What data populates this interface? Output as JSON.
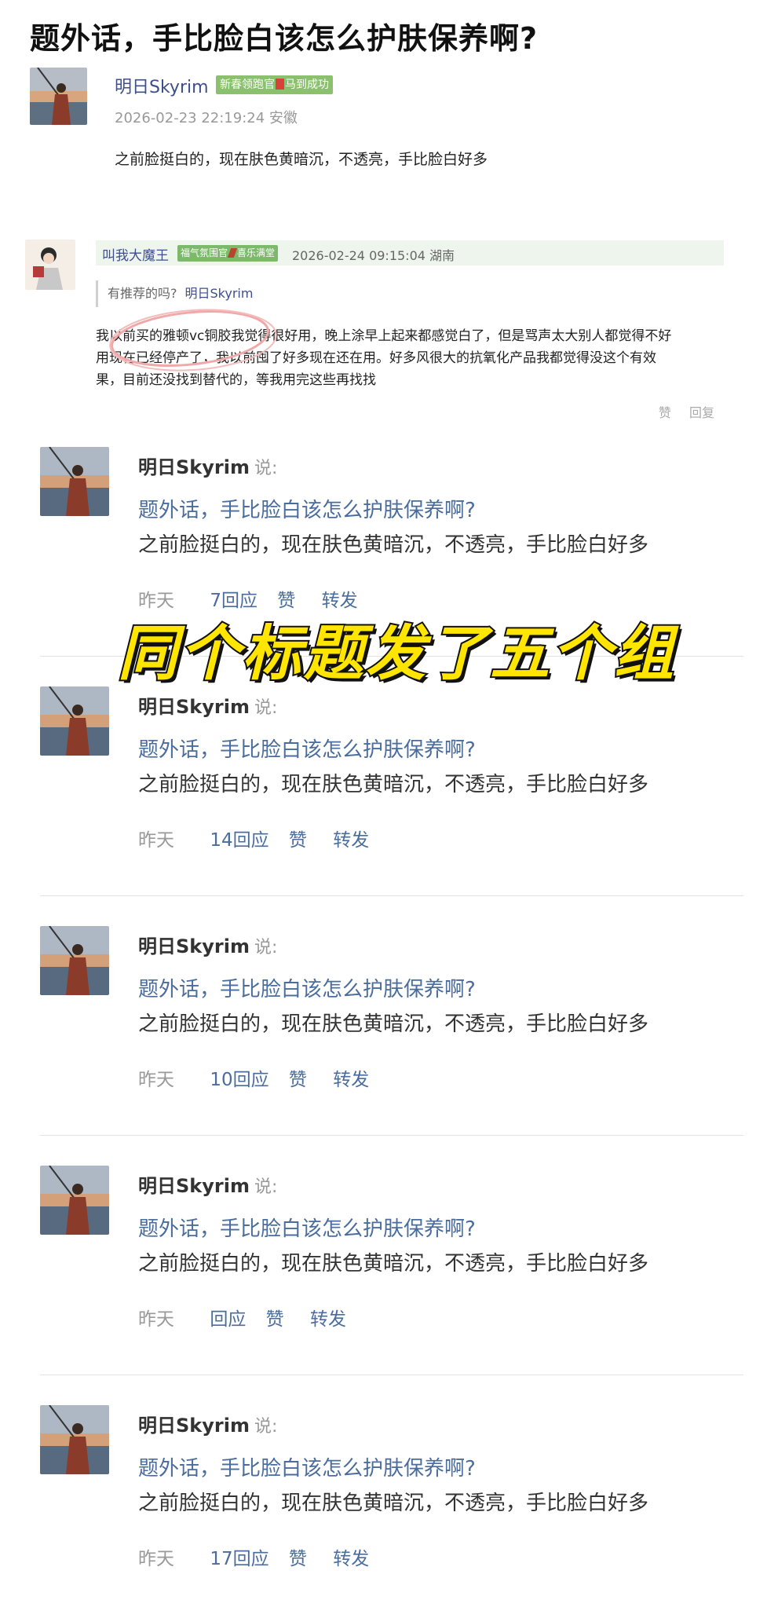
{
  "post": {
    "title": "题外话，手比脸白该怎么护肤保养啊?",
    "author": "明日Skyrim",
    "badge": {
      "before": "新春领跑官",
      "after": "马到成功"
    },
    "meta": "2026-02-23 22:19:24 安徽",
    "body": "之前脸挺白的，现在肤色黄暗沉，不透亮，手比脸白好多"
  },
  "reply": {
    "name": "叫我大魔王",
    "badge": {
      "before": "福气氛围官",
      "after": "喜乐满堂"
    },
    "time": "2026-02-24 09:15:04 湖南",
    "quote_text": "有推荐的吗?",
    "quote_name": "明日Skyrim",
    "line1": "我以前买的雅顿vc铜胶我觉得很好用，晚上涂早上起来都感觉白了，但是骂声太大别人都觉得不好",
    "line2": "用现在已经停产了，我以前囤了好多现在还在用。好多风很大的抗氧化产品我都觉得没这个有效",
    "line3": "果，目前还没找到替代的，等我用完这些再找找",
    "like": "赞",
    "reply_label": "回复"
  },
  "feed": [
    {
      "name": "明日Skyrim",
      "said": "说:",
      "title": "题外话，手比脸白该怎么护肤保养啊?",
      "body": "之前脸挺白的，现在肤色黄暗沉，不透亮，手比脸白好多",
      "time": "昨天",
      "replies": "7回应",
      "like": "赞",
      "share": "转发"
    },
    {
      "name": "明日Skyrim",
      "said": "说:",
      "title": "题外话，手比脸白该怎么护肤保养啊?",
      "body": "之前脸挺白的，现在肤色黄暗沉，不透亮，手比脸白好多",
      "time": "昨天",
      "replies": "14回应",
      "like": "赞",
      "share": "转发"
    },
    {
      "name": "明日Skyrim",
      "said": "说:",
      "title": "题外话，手比脸白该怎么护肤保养啊?",
      "body": "之前脸挺白的，现在肤色黄暗沉，不透亮，手比脸白好多",
      "time": "昨天",
      "replies": "10回应",
      "like": "赞",
      "share": "转发"
    },
    {
      "name": "明日Skyrim",
      "said": "说:",
      "title": "题外话，手比脸白该怎么护肤保养啊?",
      "body": "之前脸挺白的，现在肤色黄暗沉，不透亮，手比脸白好多",
      "time": "昨天",
      "replies": "回应",
      "like": "赞",
      "share": "转发"
    },
    {
      "name": "明日Skyrim",
      "said": "说:",
      "title": "题外话，手比脸白该怎么护肤保养啊?",
      "body": "之前脸挺白的，现在肤色黄暗沉，不透亮，手比脸白好多",
      "time": "昨天",
      "replies": "17回应",
      "like": "赞",
      "share": "转发"
    }
  ],
  "overlay_caption": "同个标题发了五个组",
  "colors": {
    "link": "#3d4f8d",
    "feed_link": "#4a6d9e",
    "badge": "#8bc06f",
    "caption": "#ffe500"
  }
}
